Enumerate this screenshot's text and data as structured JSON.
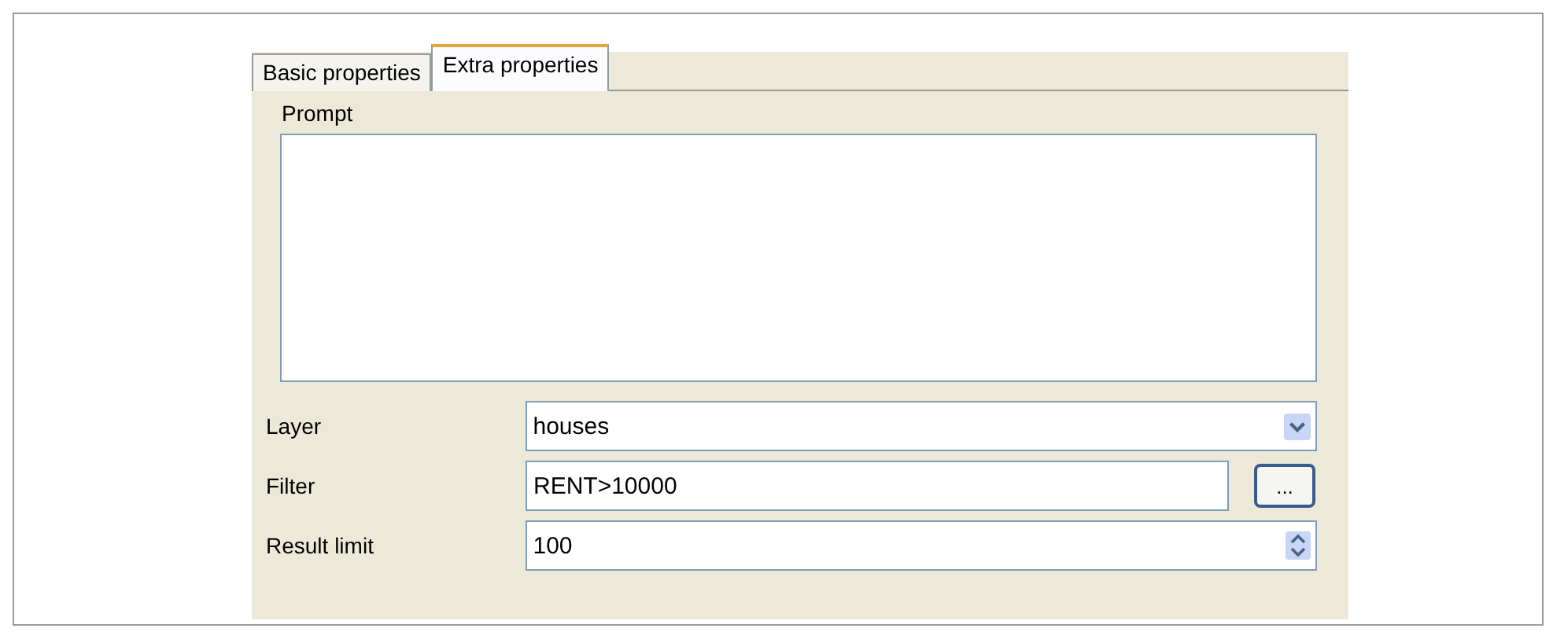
{
  "tabs": [
    {
      "label": "Basic properties",
      "selected": false
    },
    {
      "label": "Extra properties",
      "selected": true
    }
  ],
  "prompt": {
    "label": "Prompt"
  },
  "fields": [
    {
      "kind": "dropdown",
      "label": "Layer",
      "value": "houses"
    },
    {
      "kind": "browse",
      "label": "Filter",
      "value": "RENT>10000",
      "button": "..."
    },
    {
      "kind": "spinner",
      "label": "Result limit",
      "value": "100"
    }
  ]
}
